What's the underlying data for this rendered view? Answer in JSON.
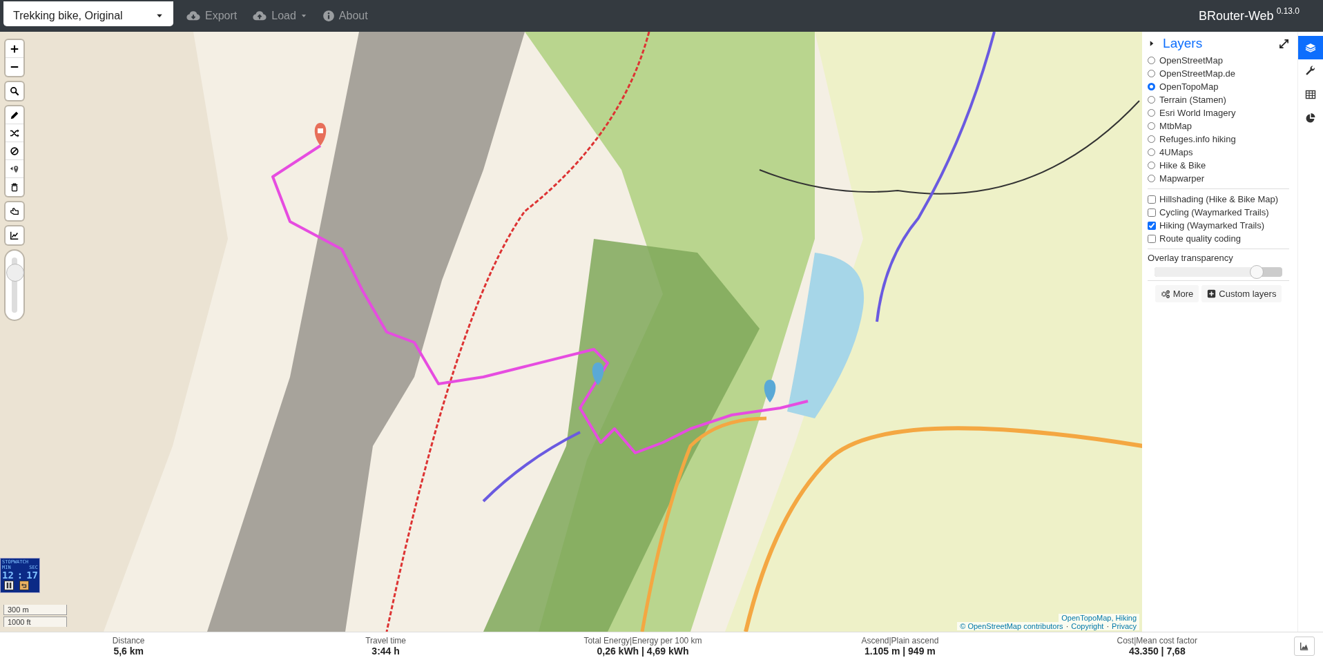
{
  "navbar": {
    "profile_select": {
      "value": "Trekking bike, Original"
    },
    "menu": [
      {
        "kind": "export",
        "label": "Export",
        "has_caret": false
      },
      {
        "kind": "load",
        "label": "Load",
        "has_caret": true
      },
      {
        "kind": "about",
        "label": "About",
        "has_caret": false
      }
    ],
    "brand": {
      "name": "BRouter-Web",
      "version": "0.13.0"
    }
  },
  "map": {
    "zoom_slider": {
      "level": 0.72
    },
    "stopwatch": {
      "title": "STOPWATCH",
      "min_label": "MIN",
      "sec_label": "SEC",
      "minutes": "12",
      "separator": ":",
      "seconds": "17"
    },
    "scale": [
      "300 m",
      "1000 ft"
    ],
    "attribution": {
      "line_1": "OpenTopoMap, Hiking",
      "line_2": [
        {
          "kind": "link",
          "text": "© OpenStreetMap contributors"
        },
        {
          "kind": "separator",
          "text": "·"
        },
        {
          "kind": "link",
          "text": "Copyright"
        },
        {
          "kind": "separator",
          "text": "·"
        },
        {
          "kind": "link",
          "text": "Privacy"
        }
      ]
    }
  },
  "layers_panel": {
    "title": "Layers",
    "base_layers": [
      {
        "label": "OpenStreetMap",
        "selected": false
      },
      {
        "label": "OpenStreetMap.de",
        "selected": false
      },
      {
        "label": "OpenTopoMap",
        "selected": true
      },
      {
        "label": "Terrain (Stamen)",
        "selected": false
      },
      {
        "label": "Esri World Imagery",
        "selected": false
      },
      {
        "label": "MtbMap",
        "selected": false
      },
      {
        "label": "Refuges.info hiking",
        "selected": false
      },
      {
        "label": "4UMaps",
        "selected": false
      },
      {
        "label": "Hike & Bike",
        "selected": false
      },
      {
        "label": "Mapwarper",
        "selected": false
      }
    ],
    "overlays": [
      {
        "label": "Hillshading (Hike & Bike Map)",
        "checked": false
      },
      {
        "label": "Cycling (Waymarked Trails)",
        "checked": false
      },
      {
        "label": "Hiking (Waymarked Trails)",
        "checked": true
      },
      {
        "label": "Route quality coding",
        "checked": false
      }
    ],
    "transparency": {
      "label": "Overlay transparency",
      "level": 0.8
    },
    "buttons": [
      {
        "kind": "more",
        "label": "More"
      },
      {
        "kind": "custom",
        "label": "Custom layers"
      }
    ]
  },
  "sidebar_tabs": [
    {
      "kind": "layers",
      "selected": true
    },
    {
      "kind": "settings",
      "selected": false
    },
    {
      "kind": "table",
      "selected": false
    },
    {
      "kind": "chart",
      "selected": false
    }
  ],
  "stats": [
    {
      "label": "Distance",
      "value": "5,6 km"
    },
    {
      "label": "Travel time",
      "value": "3:44 h"
    },
    {
      "label": "Total Energy|Energy per 100 km",
      "value": "0,26 kWh | 4,69 kWh"
    },
    {
      "label": "Ascend|Plain ascend",
      "value": "1.105 m | 949 m"
    },
    {
      "label": "Cost|Mean cost factor",
      "value": "43.350 | 7,68"
    }
  ]
}
